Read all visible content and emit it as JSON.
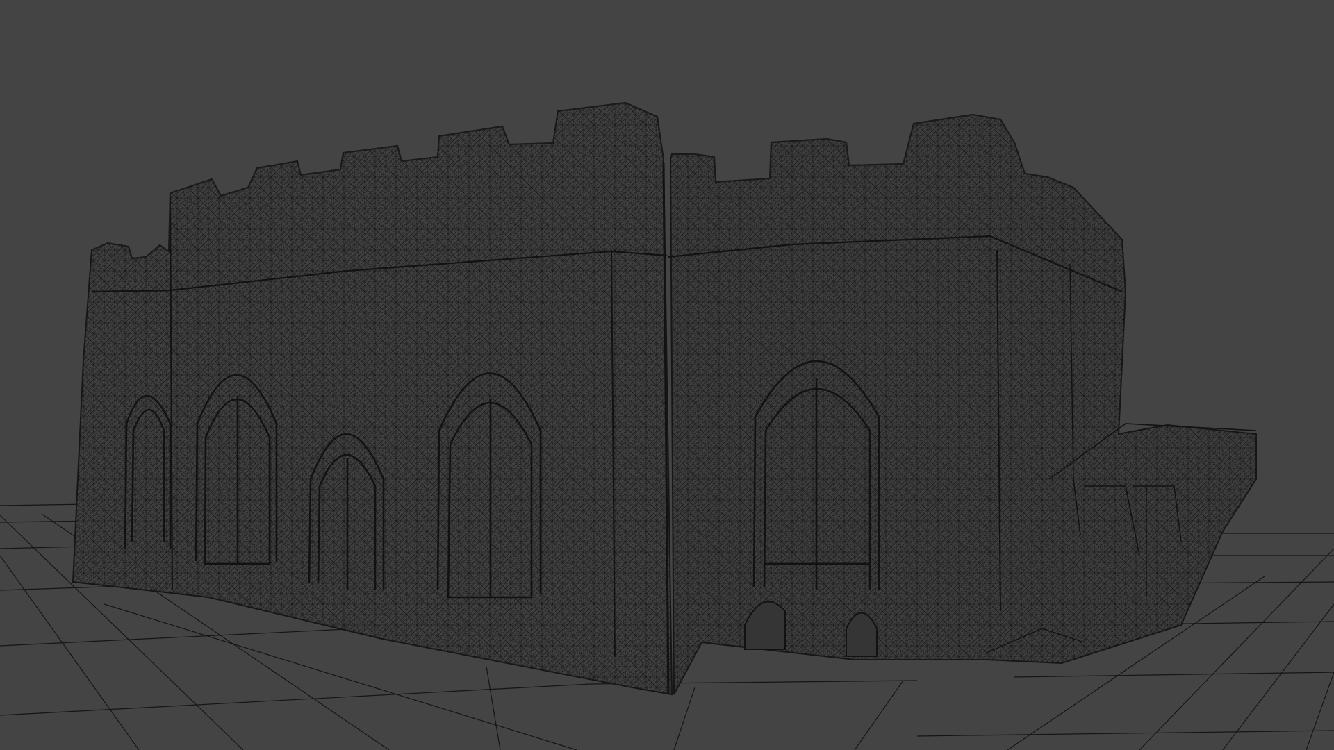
{
  "viewport": {
    "background_color": "#444444",
    "model": {
      "name_icon": "wireframe-mesh-icon",
      "display_mode": "wireframe",
      "mesh_fill_color": "#3f3f3f",
      "wire_color": "#111111"
    },
    "ground_grid": {
      "visible": true,
      "line_color": "#151515"
    }
  }
}
